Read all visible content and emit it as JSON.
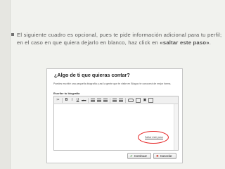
{
  "slide": {
    "paragraph_main": "El siguiente cuadro es opcional, pues te pide información adicional para tu perfil; en el caso en que quiera dejarlo en blanco, haz click en ",
    "paragraph_emph": "«saltar este paso»",
    "paragraph_end": "."
  },
  "screenshot": {
    "title": "¿Algo de ti que quieras contar?",
    "instructions": "Puedes escribir una pequeña biografía y así la gente que te visite en Blogoo te conocerá de mejor forma.",
    "bio_label": "Escribe tu biografía",
    "toolbar": {
      "cut": "✂",
      "bold": "B",
      "italic": "I",
      "underline": "U",
      "strike": "abc",
      "image": "▣"
    },
    "skip_link": "Saltar este paso",
    "continue_button": "Continuar",
    "cancel_button": "Cancelar",
    "highlight_color": "#e52222"
  }
}
